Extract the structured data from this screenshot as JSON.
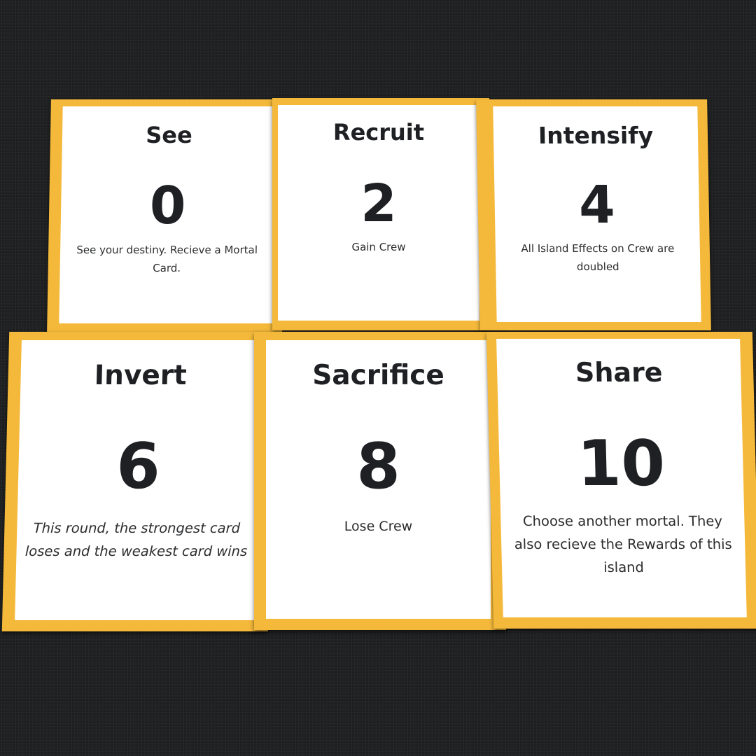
{
  "colors": {
    "table_background": "#202122",
    "card_border": "#f4b93a",
    "card_face": "#ffffff",
    "text": "#1f2023"
  },
  "cards": [
    {
      "title": "See",
      "value": "0",
      "description": "See your destiny. Recieve a Mortal Card."
    },
    {
      "title": "Recruit",
      "value": "2",
      "description": "Gain Crew"
    },
    {
      "title": "Intensify",
      "value": "4",
      "description": "All Island Effects on Crew are doubled"
    },
    {
      "title": "Invert",
      "value": "6",
      "description": "This round, the strongest card loses and the weakest card wins"
    },
    {
      "title": "Sacrifice",
      "value": "8",
      "description": "Lose Crew"
    },
    {
      "title": "Share",
      "value": "10",
      "description": "Choose another mortal. They also recieve the Rewards of this island"
    }
  ]
}
